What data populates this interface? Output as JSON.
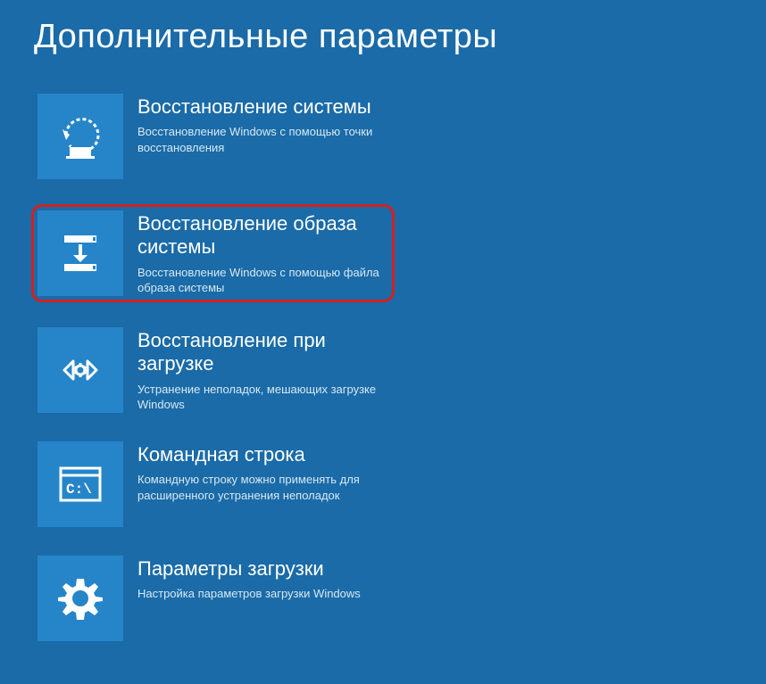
{
  "page": {
    "title": "Дополнительные параметры"
  },
  "options": {
    "system_restore": {
      "title": "Восстановление системы",
      "desc": "Восстановление Windows с помощью точки восстановления"
    },
    "image_recovery": {
      "title": "Восстановление образа системы",
      "desc": "Восстановление Windows с помощью файла образа системы"
    },
    "startup_repair": {
      "title": "Восстановление при загрузке",
      "desc": "Устранение неполадок, мешающих загрузке Windows"
    },
    "command_prompt": {
      "title": "Командная строка",
      "desc": "Командную строку можно применять для расширенного устранения неполадок"
    },
    "startup_settings": {
      "title": "Параметры загрузки",
      "desc": "Настройка параметров загрузки Windows"
    }
  }
}
